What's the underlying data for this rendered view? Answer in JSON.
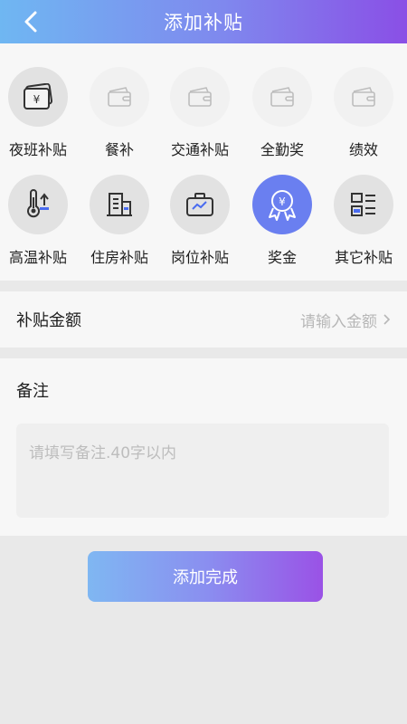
{
  "header": {
    "title": "添加补贴"
  },
  "allowances": [
    {
      "label": "夜班补贴",
      "icon": "money-card-icon",
      "style": "dark"
    },
    {
      "label": "餐补",
      "icon": "wallet-icon",
      "style": "faded"
    },
    {
      "label": "交通补贴",
      "icon": "wallet-icon",
      "style": "faded"
    },
    {
      "label": "全勤奖",
      "icon": "wallet-icon",
      "style": "faded"
    },
    {
      "label": "绩效",
      "icon": "wallet-icon",
      "style": "faded"
    },
    {
      "label": "高温补贴",
      "icon": "thermometer-icon",
      "style": "dark"
    },
    {
      "label": "住房补贴",
      "icon": "building-icon",
      "style": "dark"
    },
    {
      "label": "岗位补贴",
      "icon": "briefcase-icon",
      "style": "dark"
    },
    {
      "label": "奖金",
      "icon": "medal-icon",
      "style": "active"
    },
    {
      "label": "其它补贴",
      "icon": "list-grid-icon",
      "style": "dark"
    }
  ],
  "amount": {
    "label": "补贴金额",
    "placeholder": "请输入金额"
  },
  "notes": {
    "title": "备注",
    "placeholder": "请填写备注.40字以内"
  },
  "submit": {
    "label": "添加完成"
  },
  "colors": {
    "accent": "#6a7ff0",
    "gradient_start": "#6fb7f2",
    "gradient_end": "#8a4fe6"
  }
}
